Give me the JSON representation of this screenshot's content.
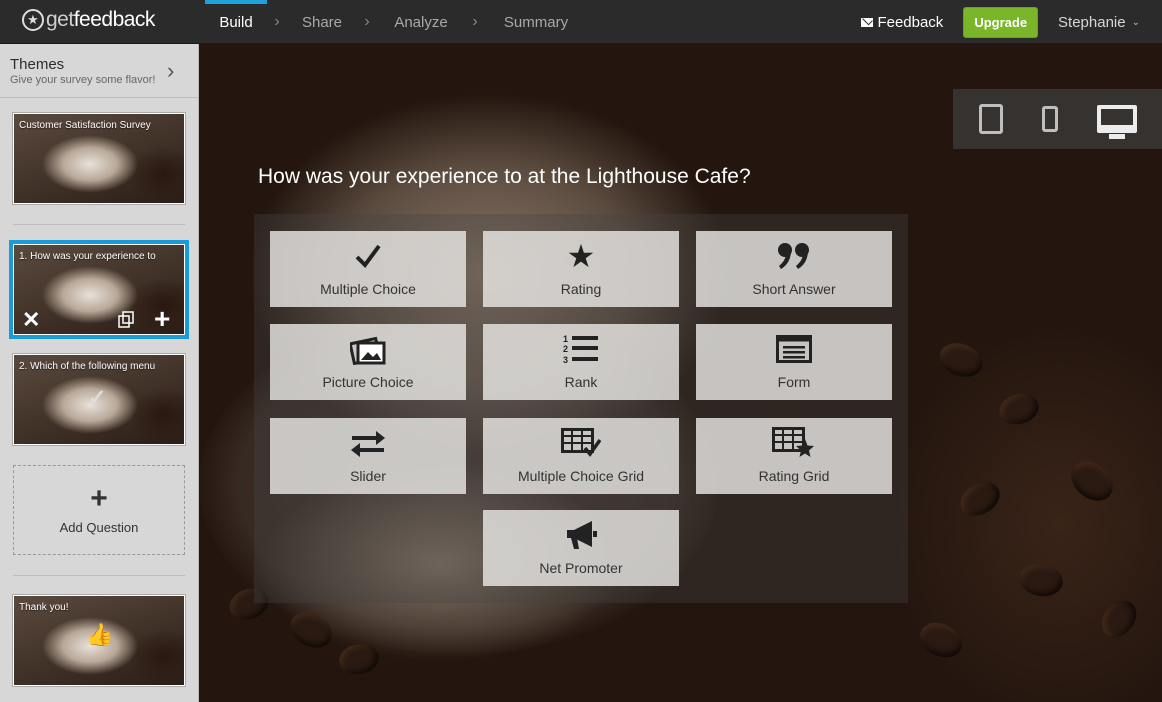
{
  "app": {
    "logo_get": "get",
    "logo_feedback": "feedback"
  },
  "nav": {
    "steps": [
      "Build",
      "Share",
      "Analyze",
      "Summary"
    ],
    "active": "Build"
  },
  "topright": {
    "feedback_label": "Feedback",
    "upgrade_label": "Upgrade",
    "user_name": "Stephanie"
  },
  "sidebar": {
    "themes_title": "Themes",
    "themes_subtitle": "Give your survey some flavor!",
    "cards": [
      {
        "label": "Customer Satisfaction Survey"
      },
      {
        "label": "1. How was your experience to"
      },
      {
        "label": "2. Which of the following menu"
      },
      {
        "label": "Thank you!"
      }
    ],
    "add_question_label": "Add Question"
  },
  "main": {
    "question_title": "How was your experience to at the Lighthouse Cafe?",
    "question_types": [
      {
        "label": "Multiple Choice",
        "icon": "checkmark-icon"
      },
      {
        "label": "Rating",
        "icon": "star-icon"
      },
      {
        "label": "Short Answer",
        "icon": "quote-icon"
      },
      {
        "label": "Picture Choice",
        "icon": "picture-icon"
      },
      {
        "label": "Rank",
        "icon": "ranked-list-icon"
      },
      {
        "label": "Form",
        "icon": "form-icon"
      },
      {
        "label": "Slider",
        "icon": "slider-arrows-icon"
      },
      {
        "label": "Multiple Choice Grid",
        "icon": "grid-check-icon"
      },
      {
        "label": "Rating Grid",
        "icon": "grid-star-icon"
      },
      {
        "label": "Net Promoter",
        "icon": "megaphone-icon"
      }
    ],
    "devices": [
      "tablet-icon",
      "phone-icon",
      "desktop-icon"
    ],
    "active_device": "desktop-icon"
  },
  "colors": {
    "accent": "#1fa2dc",
    "upgrade": "#7ab52a",
    "topbar": "#2b2b2b",
    "sidebar": "#d7d7d7"
  }
}
